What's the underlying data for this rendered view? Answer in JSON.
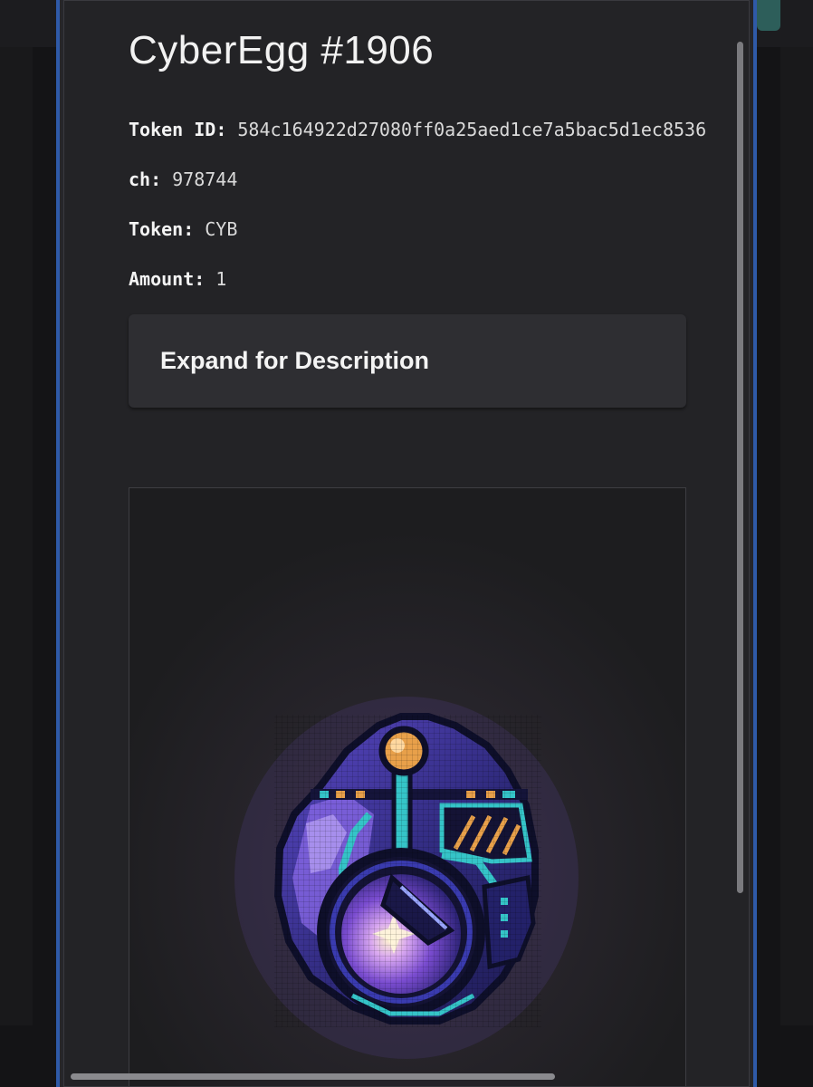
{
  "modal": {
    "title": "CyberEgg #1906",
    "fields": [
      {
        "label": "Token ID:",
        "value": "584c164922d27080ff0a25aed1ce7a5bac5d1ec8536"
      },
      {
        "label": "ch:",
        "value": "978744"
      },
      {
        "label": "Token:",
        "value": "CYB"
      },
      {
        "label": "Amount:",
        "value": "1"
      }
    ],
    "description_toggle": "Expand for Description"
  },
  "artwork": {
    "subject": "pixel-art cyber egg",
    "colors": {
      "shell": "#2b2a6e",
      "shell_light": "#6b4fd0",
      "outline": "#0e0f2a",
      "accent_cyan": "#35c4c8",
      "accent_orange": "#e8a04a",
      "core_glow": "#f6e3b0",
      "core_purple": "#8b5ad8"
    }
  },
  "colors": {
    "modal_bg": "#232326",
    "frame_blue": "#2f5aa8",
    "accordion_bg": "#2e2e32",
    "text_primary": "#f2f2f2"
  }
}
